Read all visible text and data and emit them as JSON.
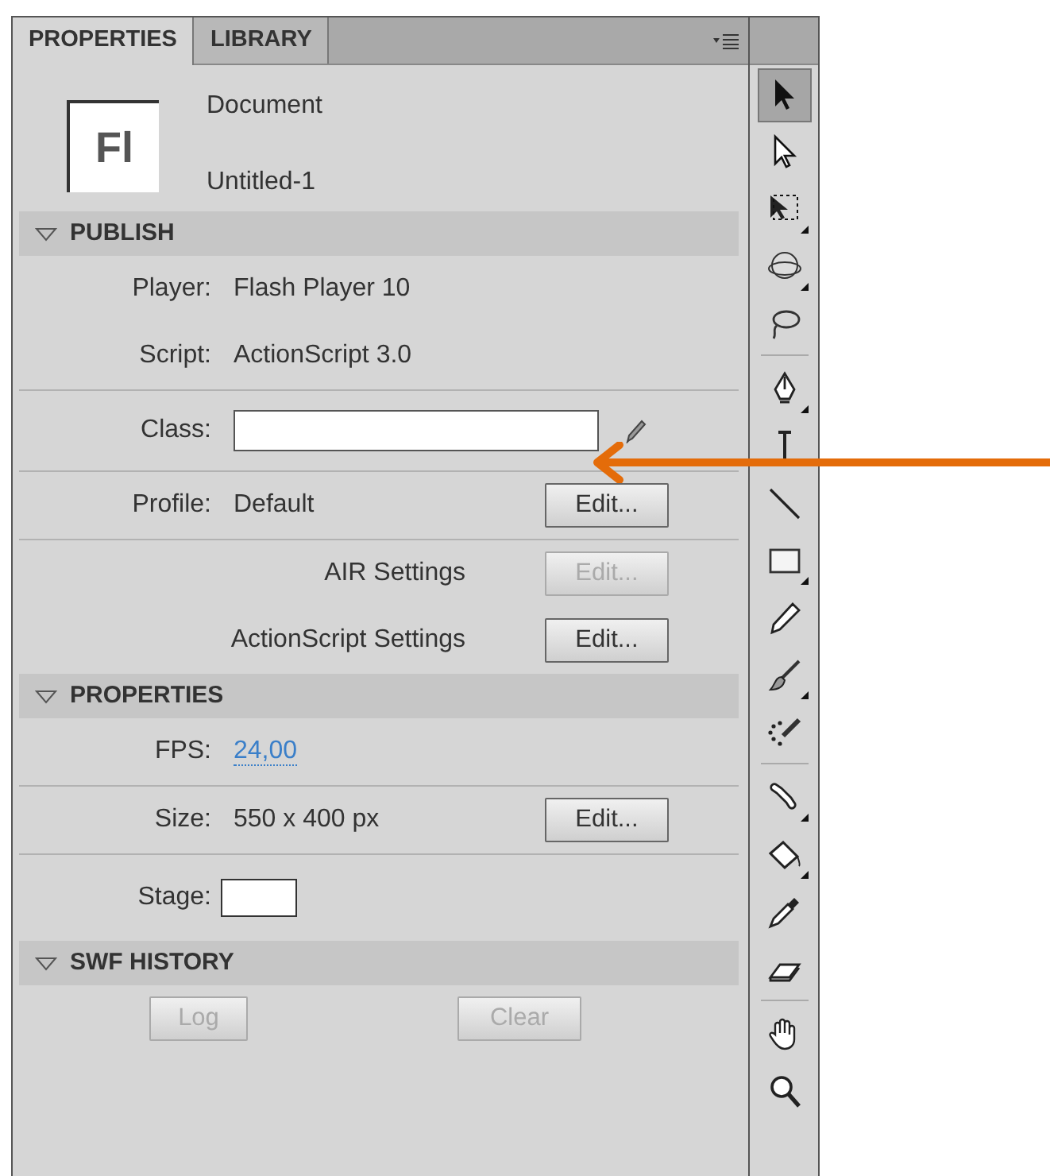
{
  "tabs": [
    {
      "label": "PROPERTIES",
      "selected": true
    },
    {
      "label": "LIBRARY",
      "selected": false
    }
  ],
  "document": {
    "icon_text": "Fl",
    "type": "Document",
    "name": "Untitled-1"
  },
  "sections": [
    {
      "title": "PUBLISH",
      "expanded": true,
      "rows": [
        {
          "kind": "pair",
          "label": "Player:",
          "value": "Flash Player 10",
          "divider": false
        },
        {
          "kind": "pair",
          "label": "Script:",
          "value": "ActionScript 3.0",
          "divider": true
        },
        {
          "kind": "field",
          "label": "Class:",
          "value": "",
          "divider": true
        },
        {
          "kind": "pair",
          "label": "Profile:",
          "value": "Default",
          "button": {
            "label": "Edit...",
            "disabled": false
          },
          "divider": true
        },
        {
          "kind": "setting",
          "label": "AIR Settings",
          "button": {
            "label": "Edit...",
            "disabled": true
          },
          "divider": false
        },
        {
          "kind": "setting",
          "label": "ActionScript Settings",
          "button": {
            "label": "Edit...",
            "disabled": false
          },
          "divider": false
        }
      ]
    },
    {
      "title": "PROPERTIES",
      "expanded": true,
      "rows": [
        {
          "kind": "link",
          "label": "FPS:",
          "value": "24,00",
          "divider": true
        },
        {
          "kind": "pair",
          "label": "Size:",
          "value": "550 x 400 px",
          "button": {
            "label": "Edit...",
            "disabled": false
          },
          "divider": true
        },
        {
          "kind": "swatch",
          "label": "Stage:",
          "divider": false
        }
      ]
    },
    {
      "title": "SWF HISTORY",
      "expanded": true,
      "rows": [
        {
          "kind": "buttons",
          "buttons": [
            {
              "label": "Log",
              "disabled": true
            },
            {
              "label": "Clear",
              "disabled": true
            }
          ],
          "divider": false
        }
      ]
    }
  ],
  "tools": [
    {
      "kind": "selection",
      "selected": true,
      "flyout": false
    },
    {
      "kind": "subselection",
      "selected": false,
      "flyout": false
    },
    {
      "kind": "free-transform",
      "selected": false,
      "flyout": true
    },
    {
      "kind": "rotation",
      "selected": false,
      "flyout": true
    },
    {
      "kind": "lasso",
      "selected": false,
      "flyout": false
    },
    {
      "kind": "separator"
    },
    {
      "kind": "pen",
      "selected": false,
      "flyout": true
    },
    {
      "kind": "text",
      "selected": false,
      "flyout": false
    },
    {
      "kind": "line",
      "selected": false,
      "flyout": false
    },
    {
      "kind": "rectangle",
      "selected": false,
      "flyout": true
    },
    {
      "kind": "pencil",
      "selected": false,
      "flyout": false
    },
    {
      "kind": "brush",
      "selected": false,
      "flyout": true
    },
    {
      "kind": "deco",
      "selected": false,
      "flyout": false
    },
    {
      "kind": "separator"
    },
    {
      "kind": "bone",
      "selected": false,
      "flyout": true
    },
    {
      "kind": "bucket",
      "selected": false,
      "flyout": true
    },
    {
      "kind": "eyedropper",
      "selected": false,
      "flyout": false
    },
    {
      "kind": "eraser",
      "selected": false,
      "flyout": false
    },
    {
      "kind": "separator"
    },
    {
      "kind": "hand",
      "selected": false,
      "flyout": false
    },
    {
      "kind": "zoom",
      "selected": false,
      "flyout": false
    }
  ],
  "annotations": [
    {
      "kind": "arrow",
      "color": "#e46c0a"
    }
  ]
}
